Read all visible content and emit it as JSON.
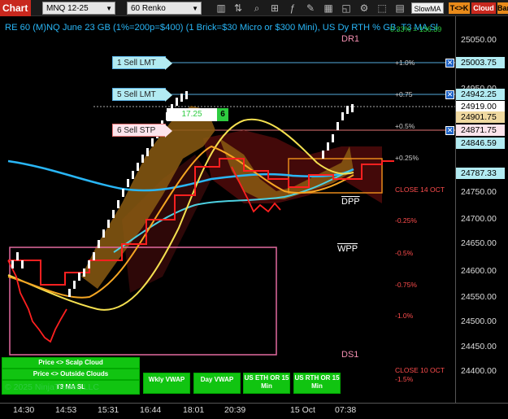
{
  "toolbar": {
    "chart_tab": "Chart",
    "instrument": "MNQ 12-25",
    "period": "60 Renko",
    "icons": [
      "bars-icon",
      "search-icon",
      "indicators-icon",
      "strategy-icon",
      "drawing-icon",
      "templates-icon",
      "replay-icon",
      "properties-icon",
      "screenshot-icon",
      "toggle-icon",
      "grid-icon"
    ],
    "slowma": "SlowMA",
    "tck": "T<>K",
    "cloud": "Cloud",
    "bar": "Bar"
  },
  "title": {
    "text": "RE 60 (M)NQ June 23 GB (1%=200p=$400) (1 Brick=$30 Micro or $300 Mini), US Dy RTH % GB, T3 MA Sl",
    "pct": "0.33% = 136.39"
  },
  "levels": {
    "dr1": "DR1",
    "ds1": "DS1",
    "dpp": "DPP",
    "wpp": "WPP"
  },
  "pct_labels": [
    {
      "text": "+1.0%",
      "cls": ""
    },
    {
      "text": "+0.75",
      "cls": ""
    },
    {
      "text": "+0.5%",
      "cls": ""
    },
    {
      "text": "+0.25%",
      "cls": ""
    },
    {
      "text": "-0.25%",
      "cls": "red"
    },
    {
      "text": "-0.5%",
      "cls": "red"
    },
    {
      "text": "-0.75%",
      "cls": "red"
    },
    {
      "text": "-1.0%",
      "cls": "red"
    },
    {
      "text": "-1.5%",
      "cls": "red"
    }
  ],
  "close_labels": {
    "c14": "CLOSE 14 OCT",
    "c10": "CLOSE 10 OCT"
  },
  "orders": {
    "lmt1": "1 Sell LMT",
    "lmt5": "5 Sell LMT",
    "stp6": "6 Sell STP",
    "pnl": "17.25",
    "qty": "6"
  },
  "price_axis": {
    "labels": [
      "25050.00",
      "24950.00",
      "24750.00",
      "24700.00",
      "24650.00",
      "24600.00",
      "24550.00",
      "24500.00",
      "24450.00",
      "24400.00"
    ],
    "tags": [
      {
        "text": "25003.75",
        "bg": "#b2ebf2"
      },
      {
        "text": "24942.25",
        "bg": "#b2ebf2"
      },
      {
        "text": "24919.00",
        "bg": "#ffffff"
      },
      {
        "text": "24901.75",
        "bg": "#f0d9a0"
      },
      {
        "text": "24871.75",
        "bg": "#fce4ec"
      },
      {
        "text": "24846.59",
        "bg": "#b2ebf2"
      },
      {
        "text": "24787.33",
        "bg": "#b2ebf2"
      }
    ]
  },
  "time_axis": {
    "labels": [
      "14:30",
      "14:53",
      "15:31",
      "16:44",
      "18:01",
      "20:39",
      "15 Oct",
      "07:38"
    ]
  },
  "buttons": {
    "scalp": "Price <> Scalp Cloud",
    "outside": "Price <> Outside Clouds",
    "t3": "T3 MA SL",
    "wkly": "Wkly VWAP",
    "day": "Day VWAP",
    "eth": "US ETH OR 15 Min",
    "rth": "US RTH OR 15 Min"
  },
  "copyright": "© 2025 NinjaTrader, LLC",
  "colors": {
    "accent_red": "#c8281e",
    "cyan": "#29b6f6",
    "green": "#2ecc40",
    "orange": "#e88a1a"
  }
}
